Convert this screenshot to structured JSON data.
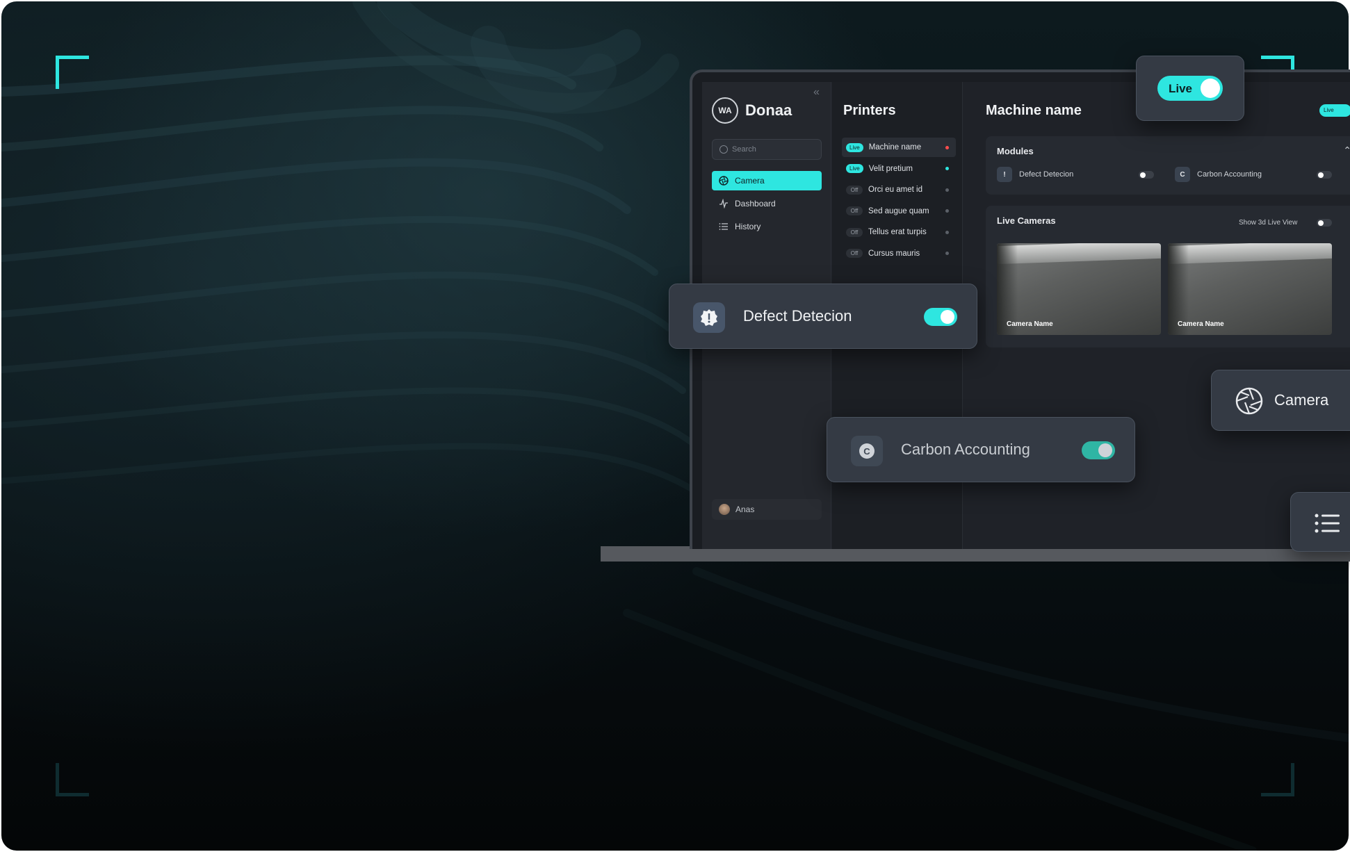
{
  "sidebar": {
    "brand": "Donaa",
    "collapse_icon": "double-chevron-left-icon",
    "search_placeholder": "Search",
    "nav": [
      {
        "label": "Camera",
        "icon": "aperture-icon",
        "active": true
      },
      {
        "label": "Dashboard",
        "icon": "activity-icon",
        "active": false
      },
      {
        "label": "History",
        "icon": "list-icon",
        "active": false
      }
    ],
    "user": "Anas"
  },
  "printers": {
    "title": "Printers",
    "items": [
      {
        "status": "Live",
        "name": "Machine name",
        "dot": "#ff4d4d"
      },
      {
        "status": "Live",
        "name": "Velit pretium",
        "dot": "#2ee6e0"
      },
      {
        "status": "Off",
        "name": "Orci eu amet id",
        "dot": "#5b6068"
      },
      {
        "status": "Off",
        "name": "Sed augue quam",
        "dot": "#5b6068"
      },
      {
        "status": "Off",
        "name": "Tellus erat turpis",
        "dot": "#5b6068"
      },
      {
        "status": "Off",
        "name": "Cursus mauris",
        "dot": "#5b6068"
      }
    ]
  },
  "detail": {
    "title": "Machine name",
    "live_badge": "Live",
    "modules": {
      "title": "Modules",
      "items": [
        {
          "label": "Defect Detecion",
          "icon_text": "!",
          "enabled": false
        },
        {
          "label": "Carbon Accounting",
          "icon_text": "C",
          "enabled": false
        }
      ]
    },
    "cameras": {
      "title": "Live Cameras",
      "toggle_label": "Show 3d Live View",
      "feeds": [
        {
          "label": "Camera Name"
        },
        {
          "label": "Camera Name"
        }
      ]
    }
  },
  "floating": {
    "live_label": "Live",
    "defect_label": "Defect Detecion",
    "carbon_label": "Carbon Accounting",
    "carbon_icon_text": "C",
    "camera_label": "Camera"
  },
  "colors": {
    "accent": "#2ee6e0",
    "background": "#0a1417",
    "panel": "#1f2228"
  }
}
